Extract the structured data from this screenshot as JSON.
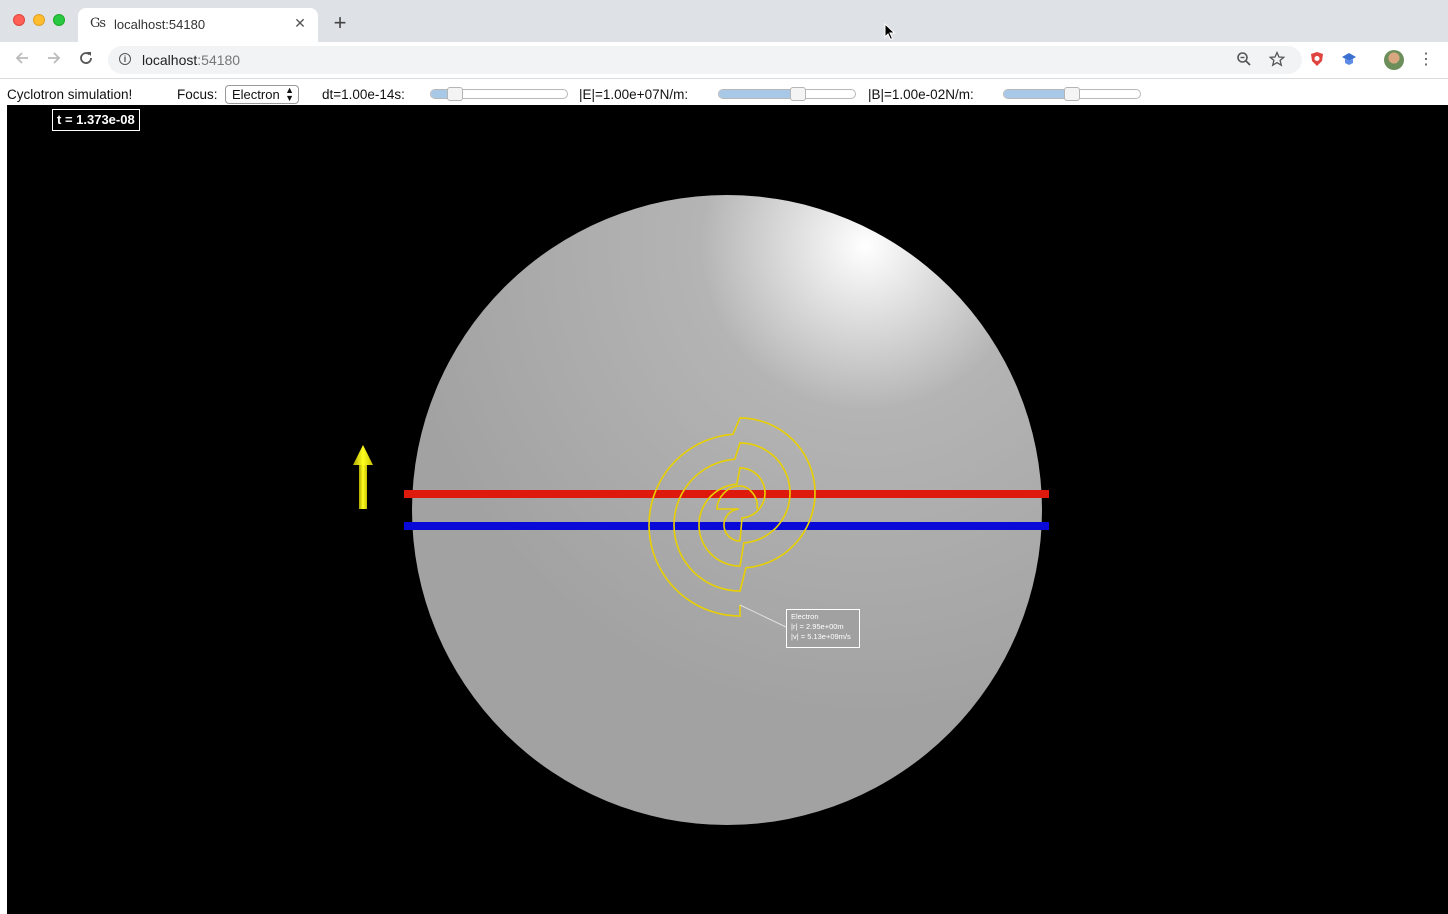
{
  "browser": {
    "tab_title": "localhost:54180",
    "tab_favicon": "Gs",
    "url_host": "localhost",
    "url_port": ":54180",
    "icons": [
      "back-arrow-icon",
      "forward-arrow-icon",
      "reload-icon",
      "info-icon",
      "zoom-icon",
      "star-icon",
      "shield-extension-icon",
      "graduation-cap-extension-icon",
      "profile-avatar",
      "more-menu-icon",
      "close-icon",
      "plus-icon"
    ]
  },
  "controls": {
    "app_title": "Cyclotron simulation!",
    "focus_label": "Focus:",
    "focus_value": "Electron",
    "dt_label": "dt=1.00e-14s:",
    "dt_slider_fraction": 0.18,
    "e_label": "|E|=1.00e+07N/m:",
    "e_slider_fraction": 0.58,
    "b_label": "|B|=1.00e-02N/m:",
    "b_slider_fraction": 0.5
  },
  "simulation": {
    "time": "t = 1.373e-08",
    "particle_name": "Electron",
    "position_readout": "|r| = 2.95e+00m",
    "velocity_readout": "|v| = 5.13e+09m/s",
    "colors": {
      "background": "#000000",
      "disc": "#a8a8a8",
      "positive_plate": "#dd1a0c",
      "negative_plate": "#0a0ad8",
      "trajectory": "#e8d000",
      "field_arrow": "#e6e000"
    }
  }
}
